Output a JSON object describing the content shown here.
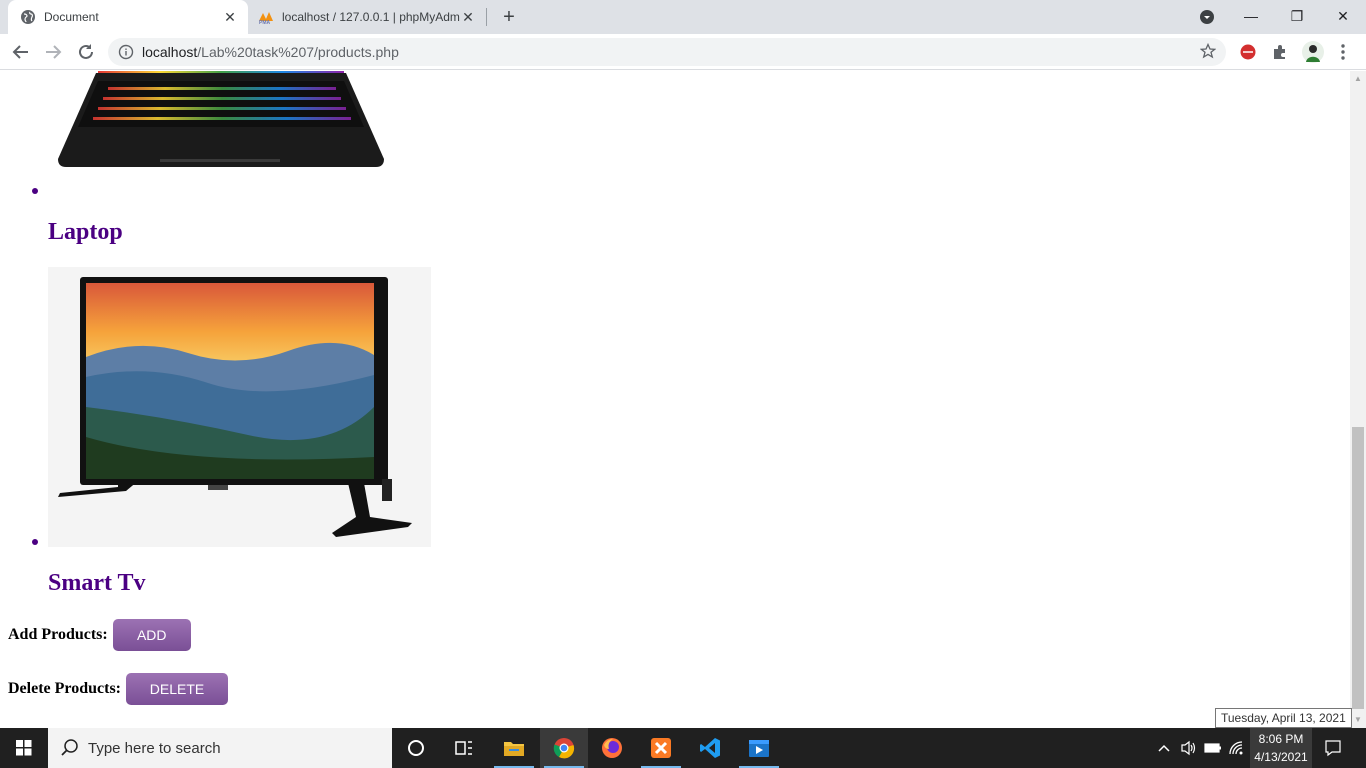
{
  "browser": {
    "tabs": [
      {
        "title": "Document",
        "active": true
      },
      {
        "title": "localhost / 127.0.0.1 | phpMyAdmin",
        "active": false
      }
    ],
    "url_host": "localhost",
    "url_path": "/Lab%20task%207/products.php"
  },
  "products": [
    {
      "name": "Laptop",
      "image": "laptop"
    },
    {
      "name": "Smart Tv",
      "image": "smart-tv"
    }
  ],
  "actions": {
    "add_label": "Add Products:",
    "add_button": "ADD",
    "delete_label": "Delete Products:",
    "delete_button": "DELETE"
  },
  "tooltip": {
    "date_full": "Tuesday, April 13, 2021"
  },
  "taskbar": {
    "search_placeholder": "Type here to search",
    "time": "8:06 PM",
    "date": "4/13/2021",
    "pinned": [
      "cortana-icon",
      "task-view-icon",
      "file-explorer-icon",
      "chrome-icon",
      "firefox-icon",
      "xampp-icon",
      "vscode-icon",
      "media-player-icon"
    ]
  },
  "colors": {
    "product_title": "#4b0082",
    "button_purple": "#8a5fa5",
    "taskbar_bg": "#202020"
  }
}
